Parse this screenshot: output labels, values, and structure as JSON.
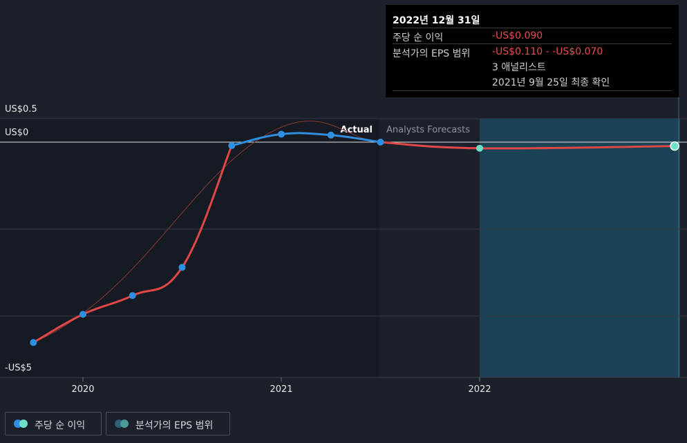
{
  "tooltip": {
    "date": "2022년 12월 31일",
    "eps_label": "주당 순 이익",
    "eps_value": "-US$0.090",
    "range_label": "분석가의 EPS 범위",
    "range_value": "-US$0.110 - -US$0.070",
    "analysts": "3 애널리스트",
    "confirmed": "2021년 9월 25일 최종 확인"
  },
  "section_labels": {
    "actual": "Actual",
    "forecast": "Analysts Forecasts"
  },
  "legend": {
    "eps": "주당 순 이익",
    "range": "분석가의 EPS 범위"
  },
  "colors": {
    "background": "#1c202b",
    "actual_line": "#2f8fe0",
    "eps_line": "#e04848",
    "forecast_dot": "#6de0c8",
    "forecast_area": "#1b4255"
  },
  "chart_data": {
    "type": "line",
    "y_tick_labels": [
      {
        "label": "US$0.5",
        "value": 0.5
      },
      {
        "label": "US$0",
        "value": 0
      },
      {
        "label": "-US$5",
        "value": -5
      }
    ],
    "x_tick_labels": [
      {
        "label": "2020",
        "value": 2020.0
      },
      {
        "label": "2021",
        "value": 2021.0
      },
      {
        "label": "2022",
        "value": 2022.0
      }
    ],
    "xlim": [
      2019.58,
      2022.95
    ],
    "ylim": [
      -5.0,
      0.5
    ],
    "gridlines_y": [
      0.5,
      0,
      -2,
      -4
    ],
    "series": [
      {
        "name": "주당 순 이익",
        "role": "actual",
        "x": [
          2019.75,
          2020.0,
          2020.25,
          2020.5,
          2020.75,
          2021.0,
          2021.25,
          2021.5
        ],
        "y": [
          -4.61,
          -3.96,
          -3.53,
          -2.88,
          -0.08,
          0.17,
          0.15,
          0.0
        ]
      },
      {
        "name": "주당 순 이익",
        "role": "forecast",
        "x": [
          2021.5,
          2022.0,
          2022.99
        ],
        "y": [
          0.0,
          -0.14,
          -0.09
        ]
      }
    ],
    "forecast_range": {
      "x_start": 2022.0,
      "x_end": 2022.99,
      "low": -0.11,
      "high": -0.07
    },
    "actual_end_x": 2021.5
  }
}
